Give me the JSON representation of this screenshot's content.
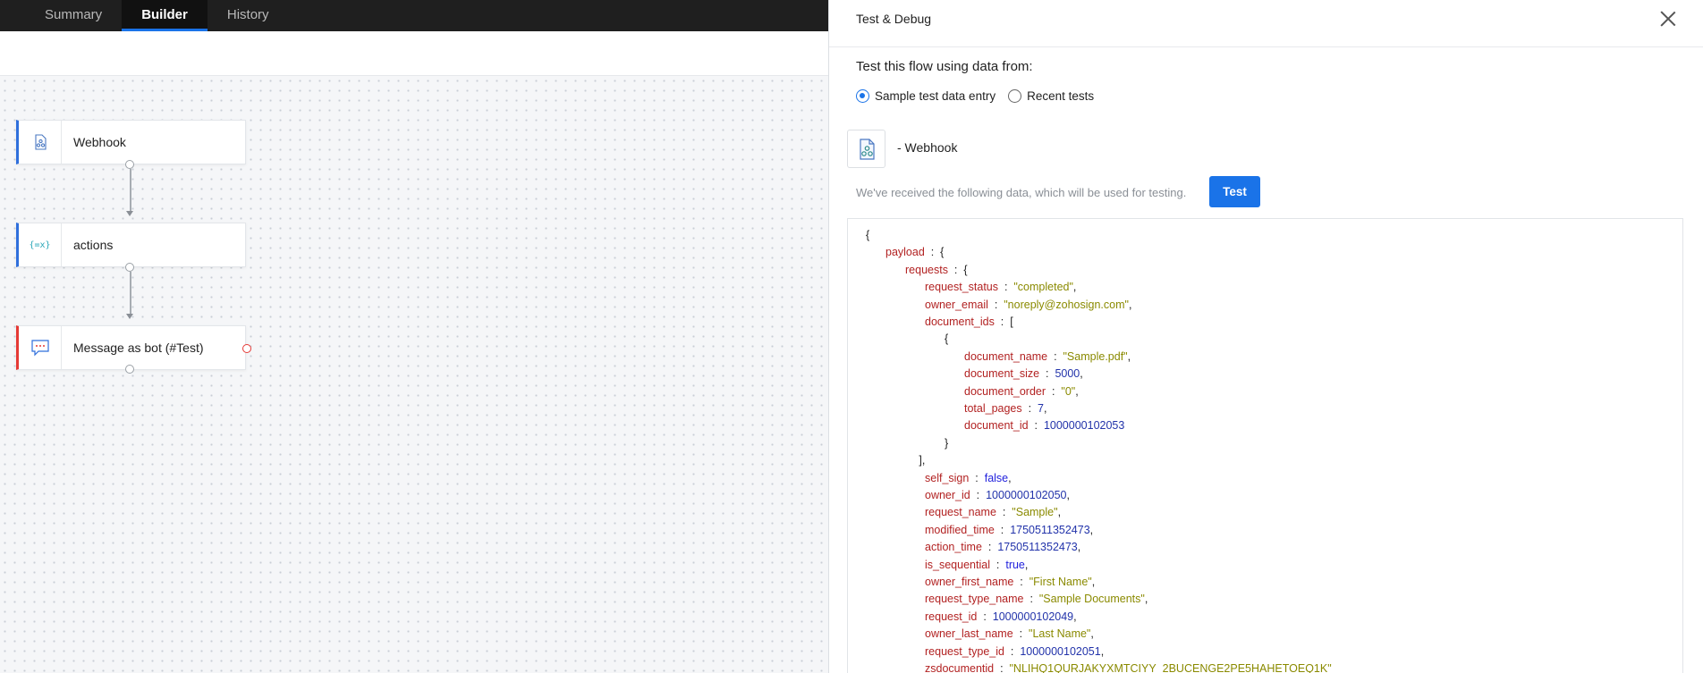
{
  "tabs": [
    {
      "label": "Summary"
    },
    {
      "label": "Builder"
    },
    {
      "label": "History"
    }
  ],
  "nodes": [
    {
      "label": "Webhook",
      "icon": "webhook-icon"
    },
    {
      "label": "actions",
      "icon": "variables-icon",
      "icon_text": "{=x}"
    },
    {
      "label": "Message as bot (#Test)",
      "icon": "chat-bubble-icon"
    }
  ],
  "panel": {
    "title": "Test & Debug",
    "section_title": "Test this flow using data from:",
    "radio_sample": "Sample test data entry",
    "radio_recent": "Recent tests",
    "trigger_name": "- Webhook",
    "info_text": "We've received the following data, which will be used for testing.",
    "test_button": "Test"
  },
  "json_lines": [
    {
      "indent": 0,
      "text": "{"
    },
    {
      "indent": 1,
      "key": "payload",
      "open": "{"
    },
    {
      "indent": 2,
      "key": "requests",
      "open": "{"
    },
    {
      "indent": 3,
      "key": "request_status",
      "value": "\"completed\"",
      "type": "s",
      "comma": true
    },
    {
      "indent": 3,
      "key": "owner_email",
      "value": "\"noreply@zohosign.com\"",
      "type": "s",
      "comma": true
    },
    {
      "indent": 3,
      "key": "document_ids",
      "open": "["
    },
    {
      "indent": 4,
      "text": "{"
    },
    {
      "indent": 5,
      "key": "document_name",
      "value": "\"Sample.pdf\"",
      "type": "s",
      "comma": true
    },
    {
      "indent": 5,
      "key": "document_size",
      "value": "5000",
      "type": "n",
      "comma": true
    },
    {
      "indent": 5,
      "key": "document_order",
      "value": "\"0\"",
      "type": "s",
      "comma": true
    },
    {
      "indent": 5,
      "key": "total_pages",
      "value": "7",
      "type": "n",
      "comma": true
    },
    {
      "indent": 5,
      "key": "document_id",
      "value": "1000000102053",
      "type": "n",
      "comma": false
    },
    {
      "indent": 4,
      "text": "}"
    },
    {
      "indent": 2.7,
      "text": "],"
    },
    {
      "indent": 3,
      "key": "self_sign",
      "value": "false",
      "type": "b",
      "comma": true
    },
    {
      "indent": 3,
      "key": "owner_id",
      "value": "1000000102050",
      "type": "n",
      "comma": true
    },
    {
      "indent": 3,
      "key": "request_name",
      "value": "\"Sample\"",
      "type": "s",
      "comma": true
    },
    {
      "indent": 3,
      "key": "modified_time",
      "value": "1750511352473",
      "type": "n",
      "comma": true
    },
    {
      "indent": 3,
      "key": "action_time",
      "value": "1750511352473",
      "type": "n",
      "comma": true
    },
    {
      "indent": 3,
      "key": "is_sequential",
      "value": "true",
      "type": "b",
      "comma": true
    },
    {
      "indent": 3,
      "key": "owner_first_name",
      "value": "\"First Name\"",
      "type": "s",
      "comma": true
    },
    {
      "indent": 3,
      "key": "request_type_name",
      "value": "\"Sample Documents\"",
      "type": "s",
      "comma": true
    },
    {
      "indent": 3,
      "key": "request_id",
      "value": "1000000102049",
      "type": "n",
      "comma": true
    },
    {
      "indent": 3,
      "key": "owner_last_name",
      "value": "\"Last Name\"",
      "type": "s",
      "comma": true
    },
    {
      "indent": 3,
      "key": "request_type_id",
      "value": "1000000102051",
      "type": "n",
      "comma": true
    },
    {
      "indent": 3,
      "key": "zsdocumentid",
      "value": "\"NLIHQ1QURJAKYXMTCIYY_2BUCENGE2PE5HAHETOEQ1K\"",
      "type": "s",
      "comma": false
    }
  ],
  "colors": {
    "accent": "#1a73e8",
    "node_border_blue": "#2f6fdc",
    "node_border_red": "#e53935",
    "json_key": "#b22222",
    "json_string": "#8a8a00",
    "json_number": "#2233aa",
    "json_bool": "#2222dd"
  }
}
